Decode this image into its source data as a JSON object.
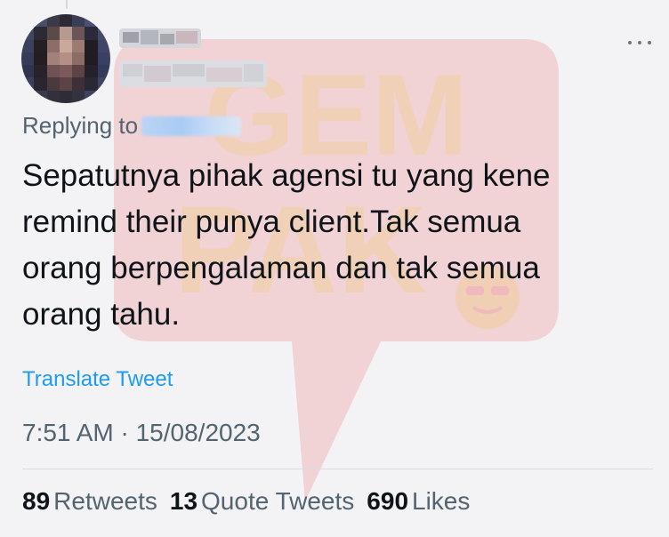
{
  "tweet": {
    "replying_label": "Replying to",
    "text": "Sepatutnya pihak agensi tu yang kene\nremind their punya client.Tak semua\norang berpengalaman dan tak semua\norang tahu.",
    "translate_label": "Translate Tweet",
    "timestamp": "7:51 AM · 15/08/2023"
  },
  "stats": {
    "retweets_count": "89",
    "retweets_label": "Retweets",
    "quotes_count": "13",
    "quotes_label": "Quote Tweets",
    "likes_count": "690",
    "likes_label": "Likes"
  },
  "watermark": {
    "line1": "GEM",
    "line2": "PAK"
  },
  "colors": {
    "background": "#f3f3f5",
    "text_primary": "#0f1419",
    "text_secondary": "#536471",
    "link": "#1d9bf0",
    "watermark_red": "#e8303a",
    "watermark_yellow": "#f5c300"
  },
  "icons": {
    "more": "more-horizontal-icon"
  }
}
